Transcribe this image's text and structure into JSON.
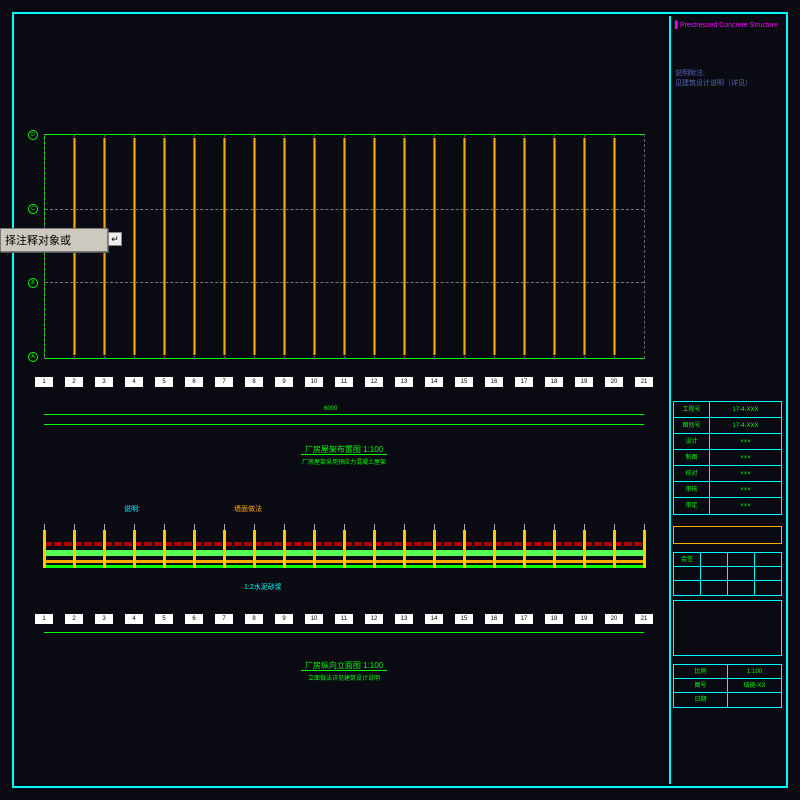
{
  "prompt": {
    "text": "择注释对象或",
    "icon_hint": "↵"
  },
  "plan_view": {
    "title": "厂房屋架布置图",
    "scale": "1:100",
    "subtitle": "厂房屋架采用预应力混凝土屋架",
    "bay_count": 20,
    "row_count": 3,
    "overall_dim": "6000",
    "axis_labels": [
      "1",
      "2",
      "3",
      "4",
      "5",
      "6",
      "7",
      "8",
      "9",
      "10",
      "11",
      "12",
      "13",
      "14",
      "15",
      "16",
      "17",
      "18",
      "19",
      "20",
      "21"
    ],
    "row_axes": [
      "A",
      "B",
      "C",
      "D"
    ]
  },
  "elevation_view": {
    "title": "厂房纵向立面图",
    "scale": "1:100",
    "subtitle": "立面做法详见建筑设计说明",
    "label_top": "说明:",
    "callout1": "墙面做法",
    "callout2": "1:2水泥砂浆"
  },
  "title_block": {
    "header_line1": "Prestressed Concrete Structure",
    "notes_label": "说明附注:",
    "notes_ref": "见建筑设计说明（详见）",
    "table_rows": [
      {
        "k": "工程号",
        "v": "17-4-XXX"
      },
      {
        "k": "图别号",
        "v": "17-4-XXX"
      },
      {
        "k": "设计",
        "v": "×××"
      },
      {
        "k": "制图",
        "v": "×××"
      },
      {
        "k": "校对",
        "v": "×××"
      },
      {
        "k": "审核",
        "v": "×××"
      },
      {
        "k": "审定",
        "v": "×××"
      }
    ],
    "sig_rows": [
      [
        "会签",
        "",
        "",
        ""
      ],
      [
        "",
        "",
        "",
        ""
      ],
      [
        "",
        "",
        "",
        ""
      ]
    ],
    "sheet_rows": [
      [
        "比例",
        "1:100"
      ],
      [
        "图号",
        "结施-XX"
      ],
      [
        "日期",
        ""
      ]
    ]
  },
  "colors": {
    "cyan": "#00ffff",
    "green": "#00ff00",
    "magenta": "#ff00ff",
    "orange": "#ffaa00"
  }
}
